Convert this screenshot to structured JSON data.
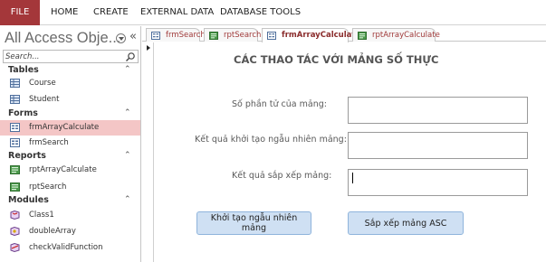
{
  "ribbon": {
    "file": "FILE",
    "home": "HOME",
    "create": "CREATE",
    "external_data": "EXTERNAL DATA",
    "database_tools": "DATABASE TOOLS"
  },
  "nav": {
    "title": "All Access Obje...",
    "search_placeholder": "Search...",
    "groups": [
      {
        "label": "Tables",
        "items": [
          "Course",
          "Student"
        ]
      },
      {
        "label": "Forms",
        "items": [
          "frmArrayCalculate",
          "frmSearch"
        ],
        "selected": "frmArrayCalculate"
      },
      {
        "label": "Reports",
        "items": [
          "rptArrayCalculate",
          "rptSearch"
        ]
      },
      {
        "label": "Modules",
        "items": [
          "Class1",
          "doubleArray",
          "checkValidFunction"
        ]
      }
    ]
  },
  "doc_tabs": [
    {
      "label": "frmSearch",
      "icon": "form-icon"
    },
    {
      "label": "rptSearch",
      "icon": "report-icon"
    },
    {
      "label": "frmArrayCalculate",
      "icon": "form-icon",
      "active": true
    },
    {
      "label": "rptArrayCalculate",
      "icon": "report-icon"
    }
  ],
  "form": {
    "title": "CÁC THAO TÁC VỚI MẢNG SỐ THỰC",
    "label_size": "Số phần tử của mảng:",
    "label_random": "Kết quả khởi tạo ngẫu nhiên mảng:",
    "label_sorted": "Kết quả sắp xếp mảng:",
    "value_size": "",
    "value_random": "",
    "value_sorted": "",
    "button_random": "Khởi tạo ngẫu nhiên mảng",
    "button_sort": "Sắp xếp mảng ASC"
  },
  "colors": {
    "file_tab": "#a4373a",
    "selected_item": "#f4c6c6",
    "button_fill": "#cfe0f3",
    "tab_text": "#a03a3a"
  }
}
